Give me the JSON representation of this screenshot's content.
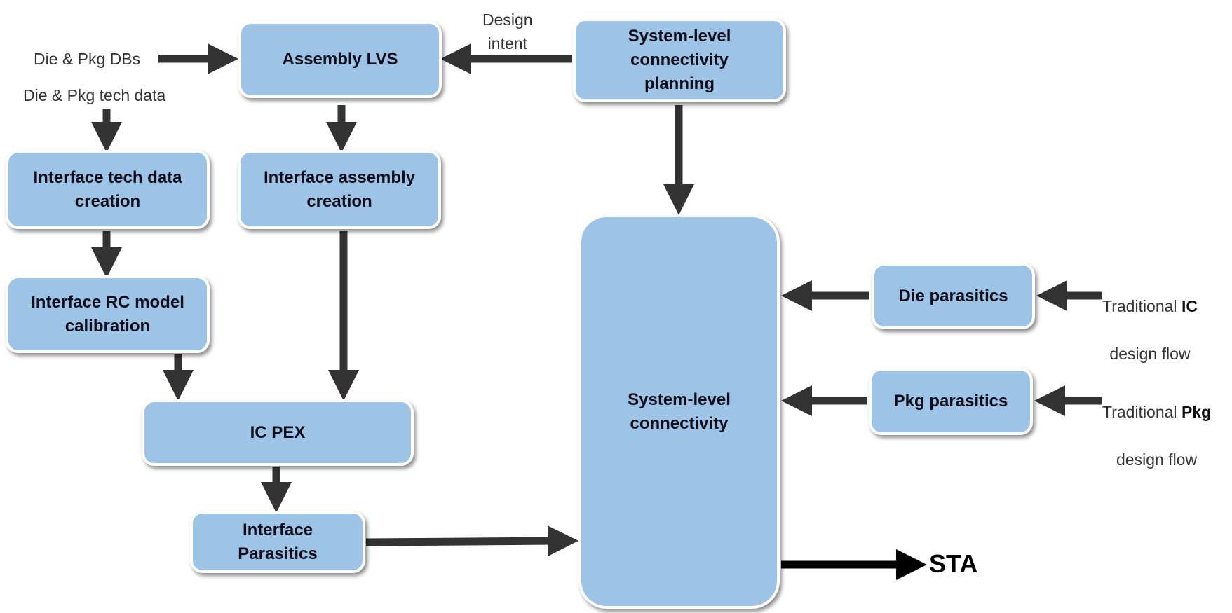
{
  "nodes": {
    "assembly_lvs": "Assembly LVS",
    "sl_planning": "System-level\nconnectivity\nplanning",
    "tech_data_creation": "Interface tech data\ncreation",
    "assembly_creation": "Interface assembly\ncreation",
    "rc_calibration": "Interface RC model\ncalibration",
    "ic_pex": "IC PEX",
    "interface_parasitics": "Interface\nParasitics",
    "sl_connectivity": "System-level\nconnectivity",
    "die_parasitics": "Die parasitics",
    "pkg_parasitics": "Pkg parasitics"
  },
  "labels": {
    "die_pkg_dbs": "Die & Pkg DBs",
    "die_pkg_tech": "Die & Pkg tech data",
    "design_intent": "Design\nintent",
    "trad_ic_prefix": "Traditional ",
    "trad_ic_bold": "IC",
    "trad_ic_suffix": "design flow",
    "trad_pkg_prefix": "Traditional ",
    "trad_pkg_bold": "Pkg",
    "trad_pkg_suffix": "design flow",
    "sta": "STA"
  },
  "colors": {
    "box_fill": "#9dc3e6",
    "arrow": "#333333",
    "sta_arrow": "#000000"
  }
}
